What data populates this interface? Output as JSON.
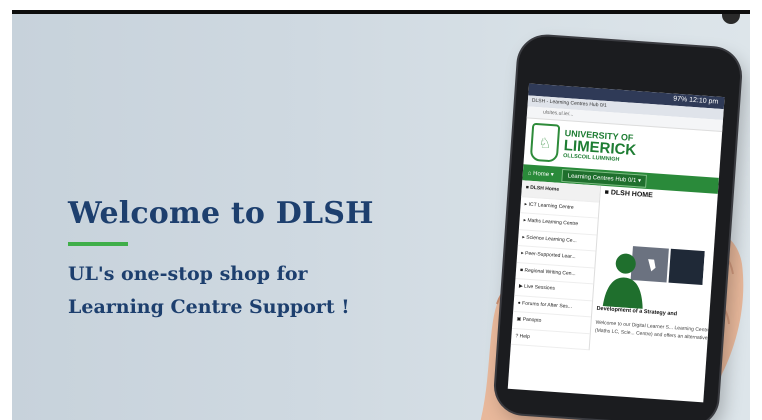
{
  "slide": {
    "headline": "Welcome to DLSH",
    "tagline_line1": "UL's one-stop shop for",
    "tagline_line2": "Learning Centre Support !",
    "colors": {
      "headline": "#1d3f6e",
      "accent": "#3fae49"
    }
  },
  "phone": {
    "status": "97% 12:10 pm",
    "tab_title": "DLSH - Learning Centres Hub 0/1",
    "url": "ulsites.ul.ie/...",
    "brand": {
      "line1": "UNIVERSITY OF",
      "line2": "LIMERICK",
      "line3": "OLLSCOIL LUIMNIGH"
    },
    "nav": {
      "home": "Home",
      "hub": "Learning Centres Hub 0/1"
    },
    "sidebar": [
      {
        "label": "DLSH Home",
        "icon": "book-icon"
      },
      {
        "label": "ICT Learning Centre",
        "icon": "chevron-right-icon"
      },
      {
        "label": "Maths Learning Centre",
        "icon": "chevron-right-icon"
      },
      {
        "label": "Science Learning Ce...",
        "icon": "chevron-right-icon"
      },
      {
        "label": "Peer-Supported Lear...",
        "icon": "chevron-right-icon"
      },
      {
        "label": "Regional Writing Cen...",
        "icon": "book-icon"
      },
      {
        "label": "Live Sessions",
        "icon": "video-icon"
      },
      {
        "label": "Forums for After Ses...",
        "icon": "chat-icon"
      },
      {
        "label": "Panopto",
        "icon": "panopto-icon"
      },
      {
        "label": "Help",
        "icon": "help-icon"
      }
    ],
    "main": {
      "heading": "DLSH HOME",
      "subheading": "Development of a Strategy and",
      "body": "Welcome to our Digital Learner S... Learning Centres (Maths LC, Scie... Centre) and offers an alternative"
    }
  }
}
